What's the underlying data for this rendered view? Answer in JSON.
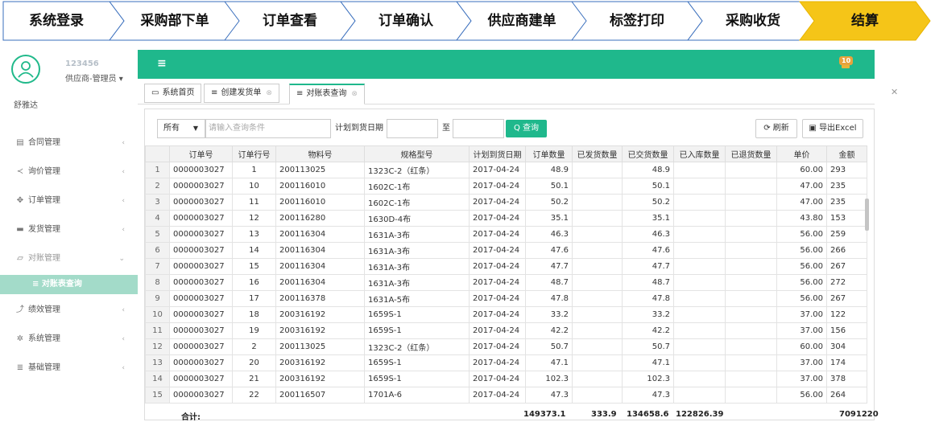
{
  "flow": {
    "steps": [
      "系统登录",
      "采购部下单",
      "订单查看",
      "订单确认",
      "供应商建单",
      "标签打印",
      "采购收货",
      "结算"
    ],
    "active_index": 7,
    "active_color": "#f5c518"
  },
  "sidebar": {
    "user_id": "123456",
    "role": "供应商-管理员",
    "name": "舒雅达",
    "menu": [
      {
        "label": "合同管理",
        "icon": "file-icon",
        "glyph": "▤"
      },
      {
        "label": "询价管理",
        "icon": "share-icon",
        "glyph": "≺"
      },
      {
        "label": "订单管理",
        "icon": "crosshair-icon",
        "glyph": "✥"
      },
      {
        "label": "发货管理",
        "icon": "truck-icon",
        "glyph": "▬"
      },
      {
        "label": "对账管理",
        "icon": "edit-icon",
        "glyph": "▱"
      },
      {
        "label": "绩效管理",
        "icon": "chart-icon",
        "glyph": "⤴"
      },
      {
        "label": "系统管理",
        "icon": "gear-icon",
        "glyph": "✲"
      },
      {
        "label": "基础管理",
        "icon": "server-icon",
        "glyph": "≣"
      }
    ],
    "submenu_label": "≡ 对账表查询"
  },
  "topbar": {
    "badge": "10",
    "accent": "#1fb88c"
  },
  "tabs": [
    {
      "label": "系统首页",
      "icon": "monitor-icon",
      "glyph": "▭"
    },
    {
      "label": "创建发货单",
      "icon": "list-icon",
      "glyph": "≡"
    },
    {
      "label": "对账表查询",
      "icon": "list-icon",
      "glyph": "≡"
    }
  ],
  "toolbar": {
    "select_value": "所有",
    "search_placeholder": "请输入查询条件",
    "date_label": "计划到货日期",
    "to_label": "至",
    "query_label": "Q 查询",
    "refresh_label": "刷新",
    "export_label": "导出Excel"
  },
  "table": {
    "columns": [
      "",
      "订单号",
      "订单行号",
      "物料号",
      "规格型号",
      "计划到货日期",
      "订单数量",
      "已发货数量",
      "已交货数量",
      "已入库数量",
      "已退货数量",
      "单价",
      "金额"
    ],
    "rows": [
      [
        "1",
        "0000003027",
        "1",
        "200113025",
        "1323C-2（红条）",
        "2017-04-24",
        "48.9",
        "",
        "48.9",
        "",
        "",
        "60.00",
        "293"
      ],
      [
        "2",
        "0000003027",
        "10",
        "200116010",
        "1602C-1布",
        "2017-04-24",
        "50.1",
        "",
        "50.1",
        "",
        "",
        "47.00",
        "235"
      ],
      [
        "3",
        "0000003027",
        "11",
        "200116010",
        "1602C-1布",
        "2017-04-24",
        "50.2",
        "",
        "50.2",
        "",
        "",
        "47.00",
        "235"
      ],
      [
        "4",
        "0000003027",
        "12",
        "200116280",
        "1630D-4布",
        "2017-04-24",
        "35.1",
        "",
        "35.1",
        "",
        "",
        "43.80",
        "153"
      ],
      [
        "5",
        "0000003027",
        "13",
        "200116304",
        "1631A-3布",
        "2017-04-24",
        "46.3",
        "",
        "46.3",
        "",
        "",
        "56.00",
        "259"
      ],
      [
        "6",
        "0000003027",
        "14",
        "200116304",
        "1631A-3布",
        "2017-04-24",
        "47.6",
        "",
        "47.6",
        "",
        "",
        "56.00",
        "266"
      ],
      [
        "7",
        "0000003027",
        "15",
        "200116304",
        "1631A-3布",
        "2017-04-24",
        "47.7",
        "",
        "47.7",
        "",
        "",
        "56.00",
        "267"
      ],
      [
        "8",
        "0000003027",
        "16",
        "200116304",
        "1631A-3布",
        "2017-04-24",
        "48.7",
        "",
        "48.7",
        "",
        "",
        "56.00",
        "272"
      ],
      [
        "9",
        "0000003027",
        "17",
        "200116378",
        "1631A-5布",
        "2017-04-24",
        "47.8",
        "",
        "47.8",
        "",
        "",
        "56.00",
        "267"
      ],
      [
        "10",
        "0000003027",
        "18",
        "200316192",
        "1659S-1",
        "2017-04-24",
        "33.2",
        "",
        "33.2",
        "",
        "",
        "37.00",
        "122"
      ],
      [
        "11",
        "0000003027",
        "19",
        "200316192",
        "1659S-1",
        "2017-04-24",
        "42.2",
        "",
        "42.2",
        "",
        "",
        "37.00",
        "156"
      ],
      [
        "12",
        "0000003027",
        "2",
        "200113025",
        "1323C-2（红条）",
        "2017-04-24",
        "50.7",
        "",
        "50.7",
        "",
        "",
        "60.00",
        "304"
      ],
      [
        "13",
        "0000003027",
        "20",
        "200316192",
        "1659S-1",
        "2017-04-24",
        "47.1",
        "",
        "47.1",
        "",
        "",
        "37.00",
        "174"
      ],
      [
        "14",
        "0000003027",
        "21",
        "200316192",
        "1659S-1",
        "2017-04-24",
        "102.3",
        "",
        "102.3",
        "",
        "",
        "37.00",
        "378"
      ],
      [
        "15",
        "0000003027",
        "22",
        "200116507",
        "1701A-6",
        "2017-04-24",
        "47.3",
        "",
        "47.3",
        "",
        "",
        "56.00",
        "264"
      ]
    ],
    "totals": {
      "label": "合计:",
      "order_qty": "149373.1",
      "shipped": "333.9",
      "delivered": "134658.6",
      "stocked": "122826.39",
      "amount": "7091220"
    }
  }
}
